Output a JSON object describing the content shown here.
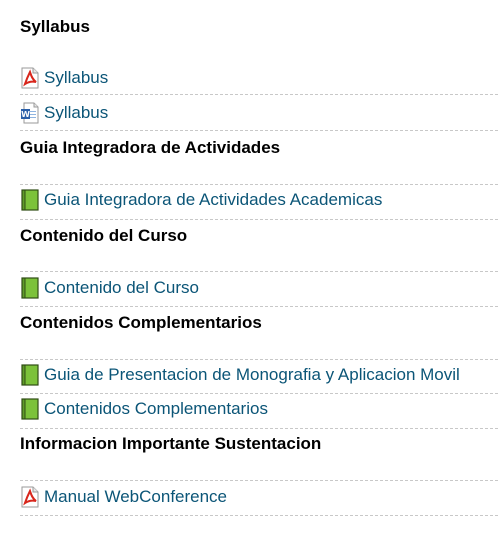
{
  "sections": [
    {
      "title": "Syllabus",
      "items": [
        {
          "icon": "pdf-icon",
          "label": "Syllabus"
        },
        {
          "icon": "word-document-icon",
          "label": "Syllabus"
        }
      ]
    },
    {
      "title": "Guia Integradora de Actividades",
      "items": [
        {
          "icon": "book-icon",
          "label": "Guia Integradora de Actividades Academicas"
        }
      ]
    },
    {
      "title": "Contenido del Curso",
      "items": [
        {
          "icon": "book-icon",
          "label": "Contenido del Curso"
        }
      ]
    },
    {
      "title": "Contenidos Complementarios",
      "items": [
        {
          "icon": "book-icon",
          "label": "Guia de Presentacion de Monografia y Aplicacion Movil"
        },
        {
          "icon": "book-icon",
          "label": "Contenidos Complementarios"
        }
      ]
    },
    {
      "title": "Informacion Importante Sustentacion",
      "items": [
        {
          "icon": "pdf-icon",
          "label": "Manual WebConference"
        }
      ]
    }
  ],
  "colors": {
    "link": "#0b5577",
    "divider": "#c8c8c8",
    "pdf_red": "#d8261c",
    "book_green": "#7cc23a",
    "word_blue": "#2b5fa8"
  }
}
